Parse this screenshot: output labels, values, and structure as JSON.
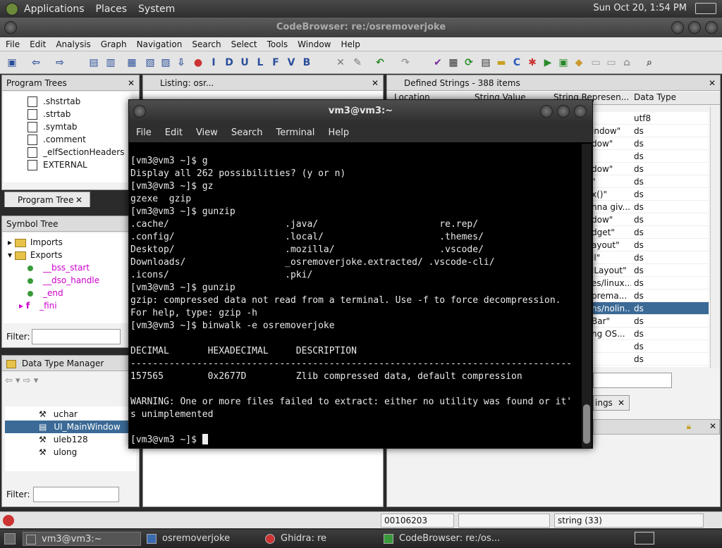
{
  "top_panel": {
    "menus": [
      "Applications",
      "Places",
      "System"
    ],
    "clock": "Sun Oct 20,  1:54 PM"
  },
  "codebrowser": {
    "title": "CodeBrowser: re:/osremoverjoke",
    "menus": [
      "File",
      "Edit",
      "Analysis",
      "Graph",
      "Navigation",
      "Search",
      "Select",
      "Tools",
      "Window",
      "Help"
    ],
    "program_trees": {
      "header": "Program Trees",
      "items": [
        ".shstrtab",
        ".strtab",
        ".symtab",
        ".comment",
        "_elfSectionHeaders",
        "EXTERNAL"
      ],
      "tab": "Program Tree"
    },
    "symbol_tree": {
      "header": "Symbol Tree",
      "imports": "Imports",
      "exports": "Exports",
      "export_items": [
        "__bss_start",
        "__dso_handle",
        "_end",
        "_fini"
      ],
      "filter_label": "Filter:"
    },
    "data_type_manager": {
      "header": "Data Type Manager",
      "items": [
        "uchar",
        "UI_MainWindow",
        "uleb128",
        "ulong"
      ],
      "filter_label": "Filter:"
    },
    "listing": {
      "header": "Listing:  osr..."
    },
    "defined_strings": {
      "header": "Defined Strings - 388 items",
      "columns": [
        "Location",
        "String Value",
        "String Represen...",
        "Data Type"
      ],
      "rows": [
        {
          "rep": "",
          "type": "utf8"
        },
        {
          "rep": "indow\"",
          "type": "ds"
        },
        {
          "rep": "dow\"",
          "type": "ds"
        },
        {
          "rep": "",
          "type": "ds"
        },
        {
          "rep": "dow\"",
          "type": "ds"
        },
        {
          "rep": "\"",
          "type": "ds"
        },
        {
          "rep": "x()\"",
          "type": "ds"
        },
        {
          "rep": "nna giv...",
          "type": "ds"
        },
        {
          "rep": "dow\"",
          "type": "ds"
        },
        {
          "rep": "dget\"",
          "type": "ds"
        },
        {
          "rep": "ayout\"",
          "type": "ds"
        },
        {
          "rep": "ll\"",
          "type": "ds"
        },
        {
          "rep": "lLayout\"",
          "type": "ds"
        },
        {
          "rep": "es/linux...",
          "type": "ds"
        },
        {
          "rep": "prema...",
          "type": "ds"
        },
        {
          "rep": "ns/nolin...",
          "type": "ds"
        },
        {
          "rep": "Bar\"",
          "type": "ds"
        },
        {
          "rep": "ng OS...",
          "type": "ds"
        },
        {
          "rep": "",
          "type": "ds"
        },
        {
          "rep": "",
          "type": "ds"
        }
      ],
      "strings_tab": "ings"
    },
    "status": {
      "address": "00106203",
      "datatype": "string (33)"
    }
  },
  "terminal": {
    "title": "vm3@vm3:~",
    "menus": [
      "File",
      "Edit",
      "View",
      "Search",
      "Terminal",
      "Help"
    ],
    "lines": [
      "[vm3@vm3 ~]$ g",
      "Display all 262 possibilities? (y or n)",
      "[vm3@vm3 ~]$ gz",
      "gzexe  gzip",
      "[vm3@vm3 ~]$ gunzip",
      ".cache/                     .java/                      re.rep/",
      ".config/                    .local/                     .themes/",
      "Desktop/                    .mozilla/                   .vscode/",
      "Downloads/                  _osremoverjoke.extracted/ .vscode-cli/",
      ".icons/                     .pki/",
      "[vm3@vm3 ~]$ gunzip",
      "gzip: compressed data not read from a terminal. Use -f to force decompression.",
      "For help, type: gzip -h",
      "[vm3@vm3 ~]$ binwalk -e osremoverjoke",
      "",
      "DECIMAL       HEXADECIMAL     DESCRIPTION",
      "--------------------------------------------------------------------------------",
      "157565        0x2677D         Zlib compressed data, default compression",
      "",
      "WARNING: One or more files failed to extract: either no utility was found or it'",
      "s unimplemented",
      ""
    ],
    "prompt": "[vm3@vm3 ~]$ "
  },
  "taskbar": {
    "tasks": [
      "vm3@vm3:~",
      "osremoverjoke",
      "Ghidra: re",
      "CodeBrowser: re:/os..."
    ]
  }
}
